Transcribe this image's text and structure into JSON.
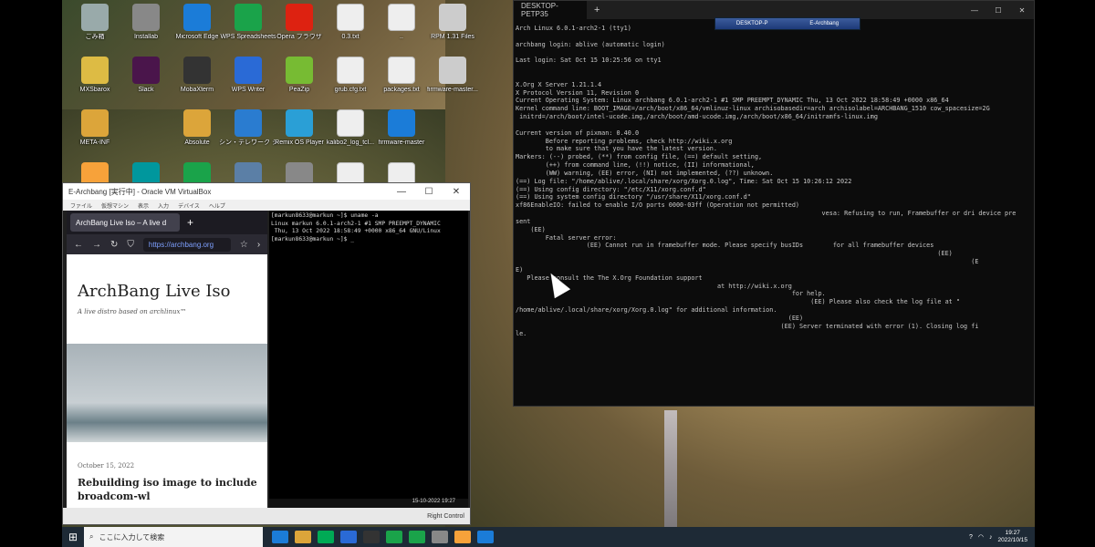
{
  "desktop": {
    "icons": [
      {
        "label": "ごみ箱",
        "color": "#9aa"
      },
      {
        "label": "Installab",
        "color": "#888"
      },
      {
        "label": "Microsoft Edge",
        "color": "#1b7cd8"
      },
      {
        "label": "WPS Spreadsheets",
        "color": "#1aa34a"
      },
      {
        "label": "Opera ブラウザ",
        "color": "#d21"
      },
      {
        "label": "0.3.txt",
        "color": "#eee"
      },
      {
        "label": "..",
        "color": "#eee"
      },
      {
        "label": "RPM 1.31 Files",
        "color": "#ccc"
      },
      {
        "label": "MXSbarox",
        "color": "#db4"
      },
      {
        "label": "Slack",
        "color": "#4a154b"
      },
      {
        "label": "MobaXterm",
        "color": "#333"
      },
      {
        "label": "WPS Writer",
        "color": "#2a6ad6"
      },
      {
        "label": "PeaZip",
        "color": "#7b3"
      },
      {
        "label": "grub.cfg.txt",
        "color": "#eee"
      },
      {
        "label": "packages.txt",
        "color": "#eee"
      },
      {
        "label": "firmware-master...",
        "color": "#ccc"
      },
      {
        "label": "META-INF",
        "color": "#dca53a"
      },
      {
        "label": "",
        "color": "transparent"
      },
      {
        "label": "Absolute",
        "color": "#dca53a"
      },
      {
        "label": "シン・テレワーク システム クライアント",
        "color": "#2a7cd0"
      },
      {
        "label": "Remix OS Player",
        "color": "#2a9fd6"
      },
      {
        "label": "kalibo2_log_tcl...",
        "color": "#eee"
      },
      {
        "label": "firmware-master",
        "color": "#1b7cd8"
      },
      {
        "label": "",
        "color": "transparent"
      },
      {
        "label": "",
        "color": "#f7a23a"
      },
      {
        "label": "",
        "color": "#00979d"
      },
      {
        "label": "",
        "color": "#1aa34a"
      },
      {
        "label": "",
        "color": "#5b7fa6"
      },
      {
        "label": "",
        "color": "#888"
      },
      {
        "label": "",
        "color": "#eee"
      },
      {
        "label": "",
        "color": "#eee"
      }
    ]
  },
  "vbox": {
    "title": "E-Archbang [実行中] - Oracle VM VirtualBox",
    "menu": [
      "ファイル",
      "仮想マシン",
      "表示",
      "入力",
      "デバイス",
      "ヘルプ"
    ],
    "status_right": "Right Control",
    "vm_clock": "15-10-2022 19:27"
  },
  "firefox": {
    "tab_title": "ArchBang Live Iso – A live d",
    "url": "https://archbang.org",
    "site_title": "ArchBang Live Iso",
    "tagline": "A live distro based on archlinux™",
    "post_date": "October 15, 2022",
    "post_title": "Rebuilding iso image to include broadcom-wl"
  },
  "vm_terminal": {
    "text": "[markun8633@markun ~]$ uname -a\nLinux markun 6.0.1-arch2-1 #1 SMP PREEMPT_DYNAMIC\n Thu, 13 Oct 2022 18:58:49 +0000 x86_64 GNU/Linux\n[markun8633@markun ~]$ _"
  },
  "windows_terminal": {
    "tab_title": "DESKTOP-PETP35",
    "vmbar_left": "DESKTOP-P",
    "vmbar_right": "E-Archbang",
    "output": "Arch Linux 6.0.1-arch2-1 (tty1)\n\narchbang login: ablive (automatic login)\n\nLast login: Sat Oct 15 10:25:56 on tty1\n\n\nX.Org X Server 1.21.1.4\nX Protocol Version 11, Revision 0\nCurrent Operating System: Linux archbang 6.0.1-arch2-1 #1 SMP PREEMPT_DYNAMIC Thu, 13 Oct 2022 18:58:49 +0000 x86_64\nKernel command line: BOOT_IMAGE=/arch/boot/x86_64/vmlinuz-linux archisobasedir=arch archisolabel=ARCHBANG_1510 cow_spacesize=2G\n initrd=/arch/boot/intel-ucode.img,/arch/boot/amd-ucode.img,/arch/boot/x86_64/initramfs-linux.img\n\nCurrent version of pixman: 0.40.0\n        Before reporting problems, check http://wiki.x.org\n        to make sure that you have the latest version.\nMarkers: (--) probed, (**) from config file, (==) default setting,\n        (++) from command line, (!!) notice, (II) informational,\n        (WW) warning, (EE) error, (NI) not implemented, (??) unknown.\n(==) Log file: \"/home/ablive/.local/share/xorg/Xorg.0.log\", Time: Sat Oct 15 10:26:12 2022\n(==) Using config directory: \"/etc/X11/xorg.conf.d\"\n(==) Using system config directory \"/usr/share/X11/xorg.conf.d\"\nxf86EnableIO: failed to enable I/O ports 0000-03ff (Operation not permitted)\n                                                                                  vesa: Refusing to run, Framebuffer or dri device pre\nsent\n    (EE)\n        Fatal server error:\n                   (EE) Cannot run in framebuffer mode. Please specify busIDs        for all framebuffer devices\n                                                                                                                 (EE)\n                                                                                                                          (E\nE)\n   Please consult the The X.Org Foundation support\n                                                      at http://wiki.x.org\n                                                                          for help.\n                                                                               (EE) Please also check the log file at \"\n/home/ablive/.local/share/xorg/Xorg.0.log\" for additional information.\n                                                                         (EE)\n                                                                       (EE) Server terminated with error (1). Closing log fi\nle."
  },
  "taskbar": {
    "search_placeholder": "ここに入力して検索",
    "time": "19:27",
    "date": "2022/10/15",
    "apps": [
      "#1b7cd8",
      "#dca53a",
      "#0a5",
      "#2a6ad6",
      "#333",
      "#1aa34a",
      "#1aa34a",
      "#888",
      "#f7a23a",
      "#1b7cd8"
    ]
  }
}
